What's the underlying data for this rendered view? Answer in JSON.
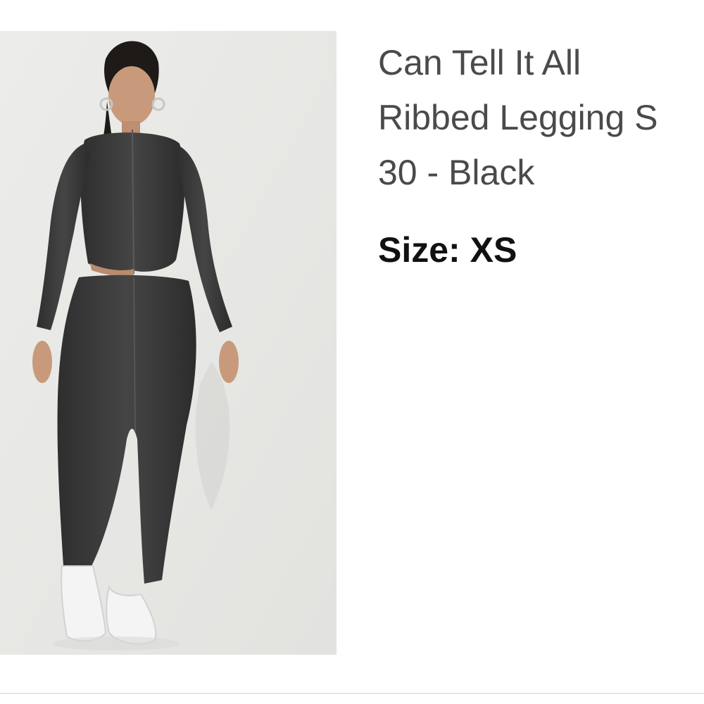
{
  "product": {
    "title_line1": "Can Tell It All",
    "title_line2": "Ribbed Legging S",
    "title_line3": "30 - Black",
    "size_label": "Size:",
    "size_value": "XS",
    "image_icon": "product-photo-model-icon"
  },
  "colors": {
    "image_background": "#e9e9e7",
    "garment": "#3b3b3b",
    "title_text": "#4a4a4a",
    "size_text": "#111111"
  }
}
